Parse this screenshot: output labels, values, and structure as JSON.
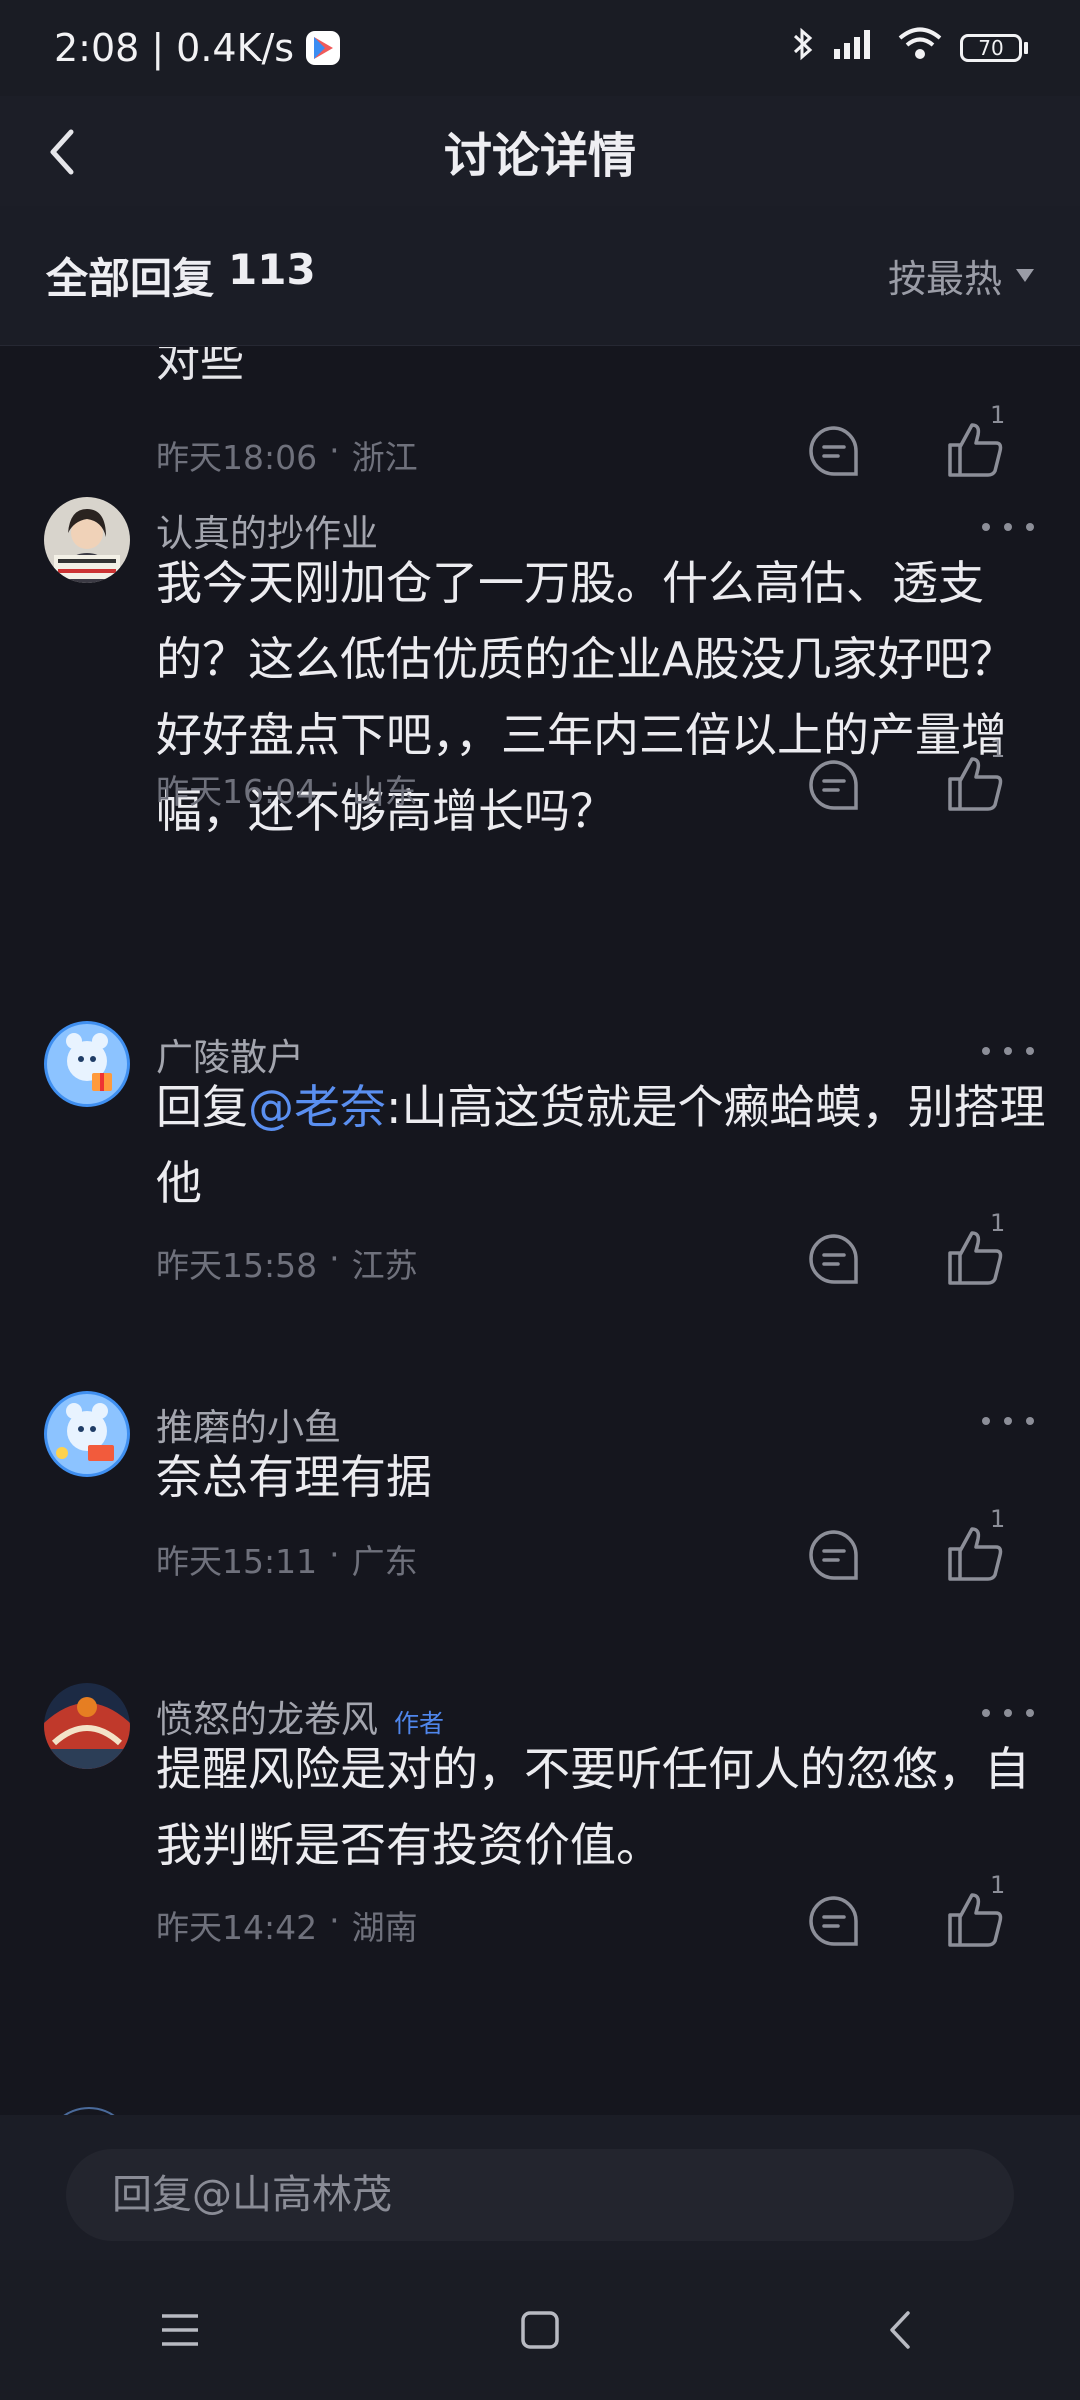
{
  "status_bar": {
    "time": "2:08",
    "network_speed": "0.4K/s",
    "battery": "70"
  },
  "header": {
    "title": "讨论详情"
  },
  "subheader": {
    "label": "全部回复",
    "count": "113",
    "sort_label": "按最热"
  },
  "partial_comment": {
    "text_tail": "对些",
    "time": "昨天18:06",
    "location": "浙江",
    "likes": "1"
  },
  "comments": [
    {
      "username": "认真的抄作业",
      "content": "我今天刚加仓了一万股。什么高估、透支的？这么低估优质的企业A股没几家好吧？好好盘点下吧，，三年内三倍以上的产量增幅，还不够高增长吗？",
      "time": "昨天16:04",
      "location": "山东",
      "likes": "1"
    },
    {
      "username": "广陵散户",
      "reply_prefix": "回复",
      "mention": "@老奈",
      "content": ":山高这货就是个癞蛤蟆，别搭理他",
      "time": "昨天15:58",
      "location": "江苏",
      "likes": "1"
    },
    {
      "username": "推磨的小鱼",
      "content": "奈总有理有据",
      "time": "昨天15:11",
      "location": "广东",
      "likes": "1"
    },
    {
      "username": "愤怒的龙卷风",
      "badge": "作者",
      "content": "提醒风险是对的，不要听任何人的忽悠，自我判断是否有投资价值。",
      "time": "昨天14:42",
      "location": "湖南",
      "likes": "1"
    }
  ],
  "reply_input": {
    "placeholder": "回复@山高林茂"
  },
  "separator": "·",
  "colors": {
    "background": "#15161e",
    "mention": "#5a8ff0",
    "author_badge": "#4f86ec"
  }
}
